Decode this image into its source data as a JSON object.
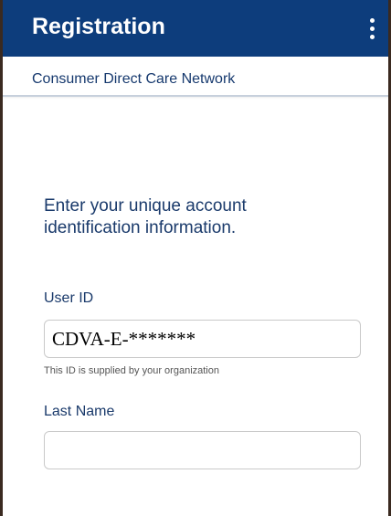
{
  "appbar": {
    "title": "Registration",
    "menu_icon": "more-vertical-icon"
  },
  "subheader": {
    "organization": "Consumer Direct Care Network"
  },
  "form": {
    "instructions": "Enter your unique account identification information.",
    "user_id": {
      "label": "User ID",
      "value": "CDVA-E-*******",
      "helper": "This ID is supplied by your organization"
    },
    "last_name": {
      "label": "Last Name",
      "value": ""
    }
  },
  "colors": {
    "appbar_background": "#0d3d7c",
    "text_primary": "#1a3a6b"
  }
}
